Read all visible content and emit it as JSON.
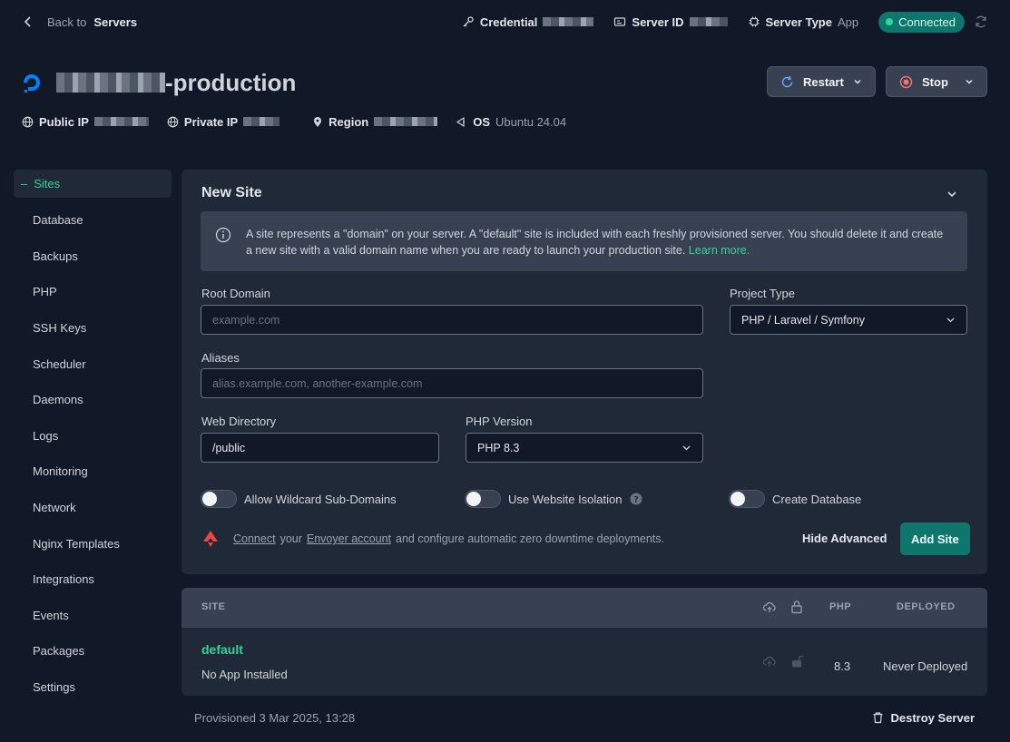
{
  "topbar": {
    "back_prefix": "Back to",
    "back_target": "Servers",
    "credential_label": "Credential",
    "server_id_label": "Server ID",
    "server_type_label": "Server Type",
    "server_type_value": "App",
    "status": "Connected"
  },
  "server": {
    "name_suffix": "-production",
    "restart_label": "Restart",
    "stop_label": "Stop",
    "public_ip_label": "Public IP",
    "private_ip_label": "Private IP",
    "region_label": "Region",
    "os_label": "OS",
    "os_value": "Ubuntu 24.04"
  },
  "sidebar": {
    "items": [
      "Sites",
      "Database",
      "Backups",
      "PHP",
      "SSH Keys",
      "Scheduler",
      "Daemons",
      "Logs",
      "Monitoring",
      "Network",
      "Nginx Templates",
      "Integrations",
      "Events",
      "Packages",
      "Settings"
    ],
    "active": "Sites"
  },
  "new_site": {
    "title": "New Site",
    "info_text": "A site represents a \"domain\" on your server. A \"default\" site is included with each freshly provisioned server. You should delete it and create a new site with a valid domain name when you are ready to launch your production site.",
    "learn_more": "Learn more.",
    "root_domain_label": "Root Domain",
    "root_domain_placeholder": "example.com",
    "project_type_label": "Project Type",
    "project_type_value": "PHP / Laravel / Symfony",
    "aliases_label": "Aliases",
    "aliases_placeholder": "alias.example.com, another-example.com",
    "web_directory_label": "Web Directory",
    "web_directory_value": "/public",
    "php_version_label": "PHP Version",
    "php_version_value": "PHP 8.3",
    "toggle_wildcard": "Allow Wildcard Sub-Domains",
    "toggle_isolation": "Use Website Isolation",
    "toggle_database": "Create Database",
    "envoyer_connect": "Connect",
    "envoyer_your": "your",
    "envoyer_account": "Envoyer account",
    "envoyer_rest": "and configure automatic zero downtime deployments.",
    "hide_advanced": "Hide Advanced",
    "add_site": "Add Site"
  },
  "sites_table": {
    "headers": {
      "site": "SITE",
      "php": "PHP",
      "deployed": "DEPLOYED"
    },
    "rows": [
      {
        "name": "default",
        "subtitle": "No App Installed",
        "php": "8.3",
        "deployed": "Never Deployed"
      }
    ]
  },
  "footer": {
    "provisioned": "Provisioned 3 Mar 2025, 13:28",
    "destroy": "Destroy Server"
  }
}
